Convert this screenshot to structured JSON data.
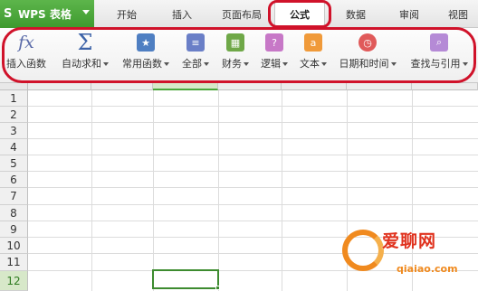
{
  "app_button": {
    "label": "WPS 表格",
    "logo": "S"
  },
  "tabs": [
    {
      "label": "开始"
    },
    {
      "label": "插入"
    },
    {
      "label": "页面布局"
    },
    {
      "label": "公式"
    },
    {
      "label": "数据"
    },
    {
      "label": "审阅"
    },
    {
      "label": "视图"
    }
  ],
  "ribbon": {
    "insert_function": {
      "label": "插入函数",
      "icon": "fx"
    },
    "autosum": {
      "label": "自动求和",
      "icon": "Σ"
    },
    "common_functions": {
      "label": "常用函数"
    },
    "all": {
      "label": "全部"
    },
    "financial": {
      "label": "财务"
    },
    "logical": {
      "label": "逻辑",
      "icon": "?"
    },
    "text": {
      "label": "文本"
    },
    "datetime": {
      "label": "日期和时间"
    },
    "lookup": {
      "label": "查找与引用"
    }
  },
  "colors": {
    "accent": "#3e9a2e",
    "highlight": "#d0122a"
  },
  "row_numbers": [
    "1",
    "2",
    "3",
    "4",
    "5",
    "6",
    "7",
    "8",
    "9",
    "10",
    "11",
    "12"
  ],
  "watermark": {
    "name": "爱聊网",
    "url": "qiaiao.com"
  }
}
